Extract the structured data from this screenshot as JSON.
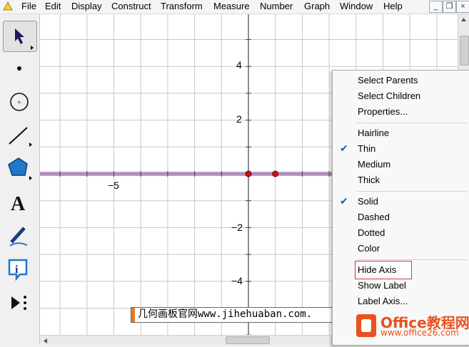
{
  "menubar": {
    "items": [
      "File",
      "Edit",
      "Display",
      "Construct",
      "Transform",
      "Measure",
      "Number",
      "Graph",
      "Window",
      "Help"
    ],
    "window_buttons": [
      "_",
      "❐",
      "×"
    ]
  },
  "toolbox": {
    "tools": [
      "selection-arrow",
      "point",
      "compass",
      "straightedge",
      "polygon",
      "text",
      "marker",
      "information",
      "custom-tools"
    ]
  },
  "axes": {
    "y_ticks": [
      "4",
      "2",
      "−2",
      "−4"
    ],
    "x_ticks": [
      "−5"
    ]
  },
  "context_menu": {
    "items": [
      {
        "label": "Select Parents",
        "checked": false
      },
      {
        "label": "Select Children",
        "checked": false
      },
      {
        "label": "Properties...",
        "checked": false
      },
      {
        "label": "Hairline",
        "checked": false
      },
      {
        "label": "Thin",
        "checked": true
      },
      {
        "label": "Medium",
        "checked": false
      },
      {
        "label": "Thick",
        "checked": false
      },
      {
        "label": "Solid",
        "checked": true
      },
      {
        "label": "Dashed",
        "checked": false
      },
      {
        "label": "Dotted",
        "checked": false
      },
      {
        "label": "Color",
        "checked": false
      },
      {
        "label": "Hide Axis",
        "checked": false,
        "highlighted": true
      },
      {
        "label": "Show Label",
        "checked": false
      },
      {
        "label": "Label Axis...",
        "checked": false
      }
    ],
    "check_mark": "✔"
  },
  "watermark": {
    "text": "几何画板官网www.jihehuaban.com."
  },
  "logo": {
    "title": "Office教程网",
    "url": "www.office26.com"
  },
  "colors": {
    "axis": "#7b3f8e",
    "point": "#d01010",
    "grid": "#c8c8c8",
    "highlight_box": "#d9363e",
    "logo": "#e8521f"
  }
}
